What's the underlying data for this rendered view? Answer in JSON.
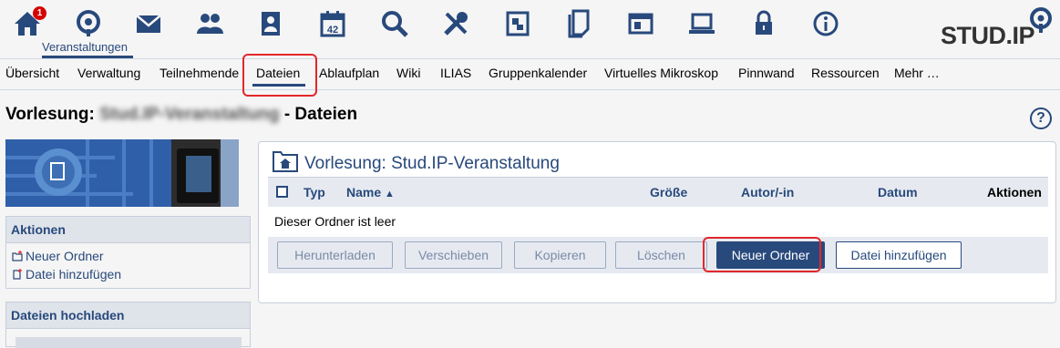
{
  "topnav": {
    "badge_count": "1",
    "active_label": "Veranstaltungen",
    "icons": [
      "home-icon",
      "courses-icon",
      "messages-icon",
      "community-icon",
      "profile-icon",
      "calendar-icon",
      "search-icon",
      "tools-icon",
      "browse-icon",
      "files-icon",
      "admin-icon",
      "computer-icon",
      "lock-icon",
      "info-icon"
    ]
  },
  "logo": {
    "text": "STUD.IP"
  },
  "tabs": [
    "Übersicht",
    "Verwaltung",
    "Teilnehmende",
    "Dateien",
    "Ablaufplan",
    "Wiki",
    "ILIAS",
    "Gruppenkalender",
    "Virtuelles Mikroskop",
    "Pinnwand",
    "Ressourcen",
    "Mehr …"
  ],
  "active_tab": "Dateien",
  "page": {
    "title_prefix": "Vorlesung:",
    "title_blurred": "Stud.IP-Veranstaltung",
    "title_suffix": "- Dateien",
    "help": "?"
  },
  "sidebar": {
    "actions_title": "Aktionen",
    "actions": [
      "Neuer Ordner",
      "Datei hinzufügen"
    ],
    "upload_title": "Dateien hochladen"
  },
  "files": {
    "caption": "Vorlesung: Stud.IP-Veranstaltung",
    "columns": {
      "type": "Typ",
      "name": "Name",
      "sort_indicator": "▲",
      "size": "Größe",
      "author": "Autor/-in",
      "date": "Datum",
      "actions": "Aktionen"
    },
    "empty_message": "Dieser Ordner ist leer",
    "buttons": [
      "Herunterladen",
      "Verschieben",
      "Kopieren",
      "Löschen",
      "Neuer Ordner",
      "Datei hinzufügen"
    ]
  },
  "colors": {
    "brand": "#28497c",
    "highlight": "#e2272a",
    "badge": "#d60000"
  }
}
